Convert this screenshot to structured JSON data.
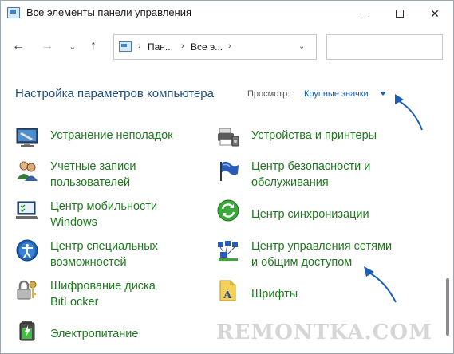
{
  "window": {
    "title": "Все элементы панели управления"
  },
  "navbar": {
    "back_icon": "arrow-left-icon",
    "forward_icon": "arrow-right-icon",
    "up_icon": "arrow-up-icon",
    "address": {
      "crumbs": [
        "Пан...",
        "Все э..."
      ]
    },
    "search_placeholder": ""
  },
  "header": {
    "title": "Настройка параметров компьютера",
    "view_label": "Просмотр:",
    "view_value": "Крупные значки"
  },
  "items": [
    {
      "label_lines": [
        "Устранение неполадок"
      ],
      "icon": "troubleshooting-icon"
    },
    {
      "label_lines": [
        "Устройства и принтеры"
      ],
      "icon": "printer-icon"
    },
    {
      "label_lines": [
        "Учетные записи",
        "пользователей"
      ],
      "icon": "users-icon"
    },
    {
      "label_lines": [
        "Центр безопасности и",
        "обслуживания"
      ],
      "icon": "flag-icon"
    },
    {
      "label_lines": [
        "Центр мобильности",
        "Windows"
      ],
      "icon": "mobility-icon"
    },
    {
      "label_lines": [
        "Центр синхронизации"
      ],
      "icon": "sync-icon"
    },
    {
      "label_lines": [
        "Центр специальных",
        "возможностей"
      ],
      "icon": "accessibility-icon"
    },
    {
      "label_lines": [
        "Центр управления сетями",
        "и общим доступом"
      ],
      "icon": "network-icon"
    },
    {
      "label_lines": [
        "Шифрование диска",
        "BitLocker"
      ],
      "icon": "bitlocker-icon"
    },
    {
      "label_lines": [
        "Шрифты"
      ],
      "icon": "fonts-icon"
    },
    {
      "label_lines": [
        "Электропитание"
      ],
      "icon": "power-icon"
    }
  ],
  "watermark": "REMONTKA.COM",
  "colors": {
    "link_green": "#1e7a1e",
    "title_blue": "#1f4e79",
    "accent_blue": "#1a5fb4"
  }
}
